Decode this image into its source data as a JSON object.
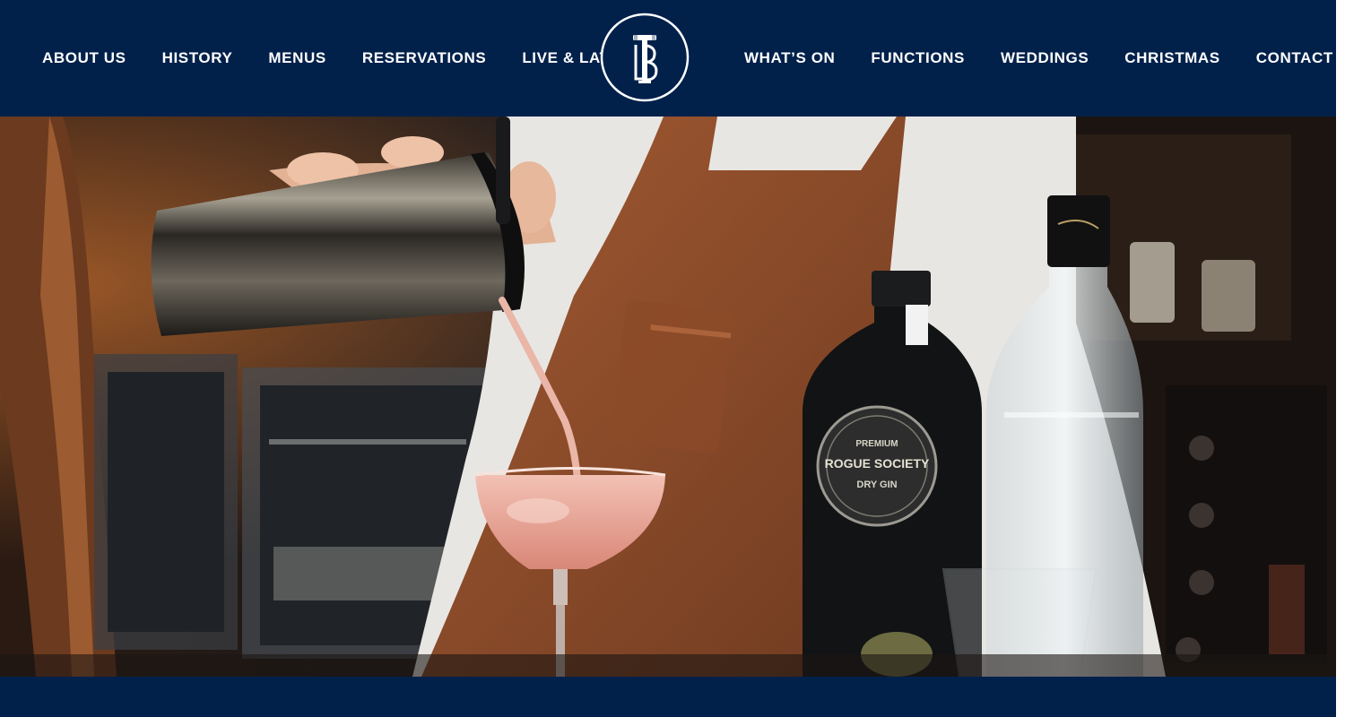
{
  "header": {
    "nav_left": [
      {
        "label": "ABOUT US"
      },
      {
        "label": "HISTORY"
      },
      {
        "label": "MENUS"
      },
      {
        "label": "RESERVATIONS"
      },
      {
        "label": "LIVE & LATE"
      }
    ],
    "nav_right": [
      {
        "label": "WHAT’S ON"
      },
      {
        "label": "FUNCTIONS"
      },
      {
        "label": "WEDDINGS"
      },
      {
        "label": "CHRISTMAS"
      },
      {
        "label": "CONTACT US"
      }
    ],
    "logo_letters": "TB"
  },
  "hero": {
    "bottle_label_line1": "PREMIUM",
    "bottle_label_line2": "ROGUE SOCIETY",
    "bottle_label_line3": "DRY GIN"
  },
  "colors": {
    "navy": "#01214b",
    "white": "#ffffff",
    "apron": "#8a4a2a",
    "cocktail": "#e79b8c"
  }
}
